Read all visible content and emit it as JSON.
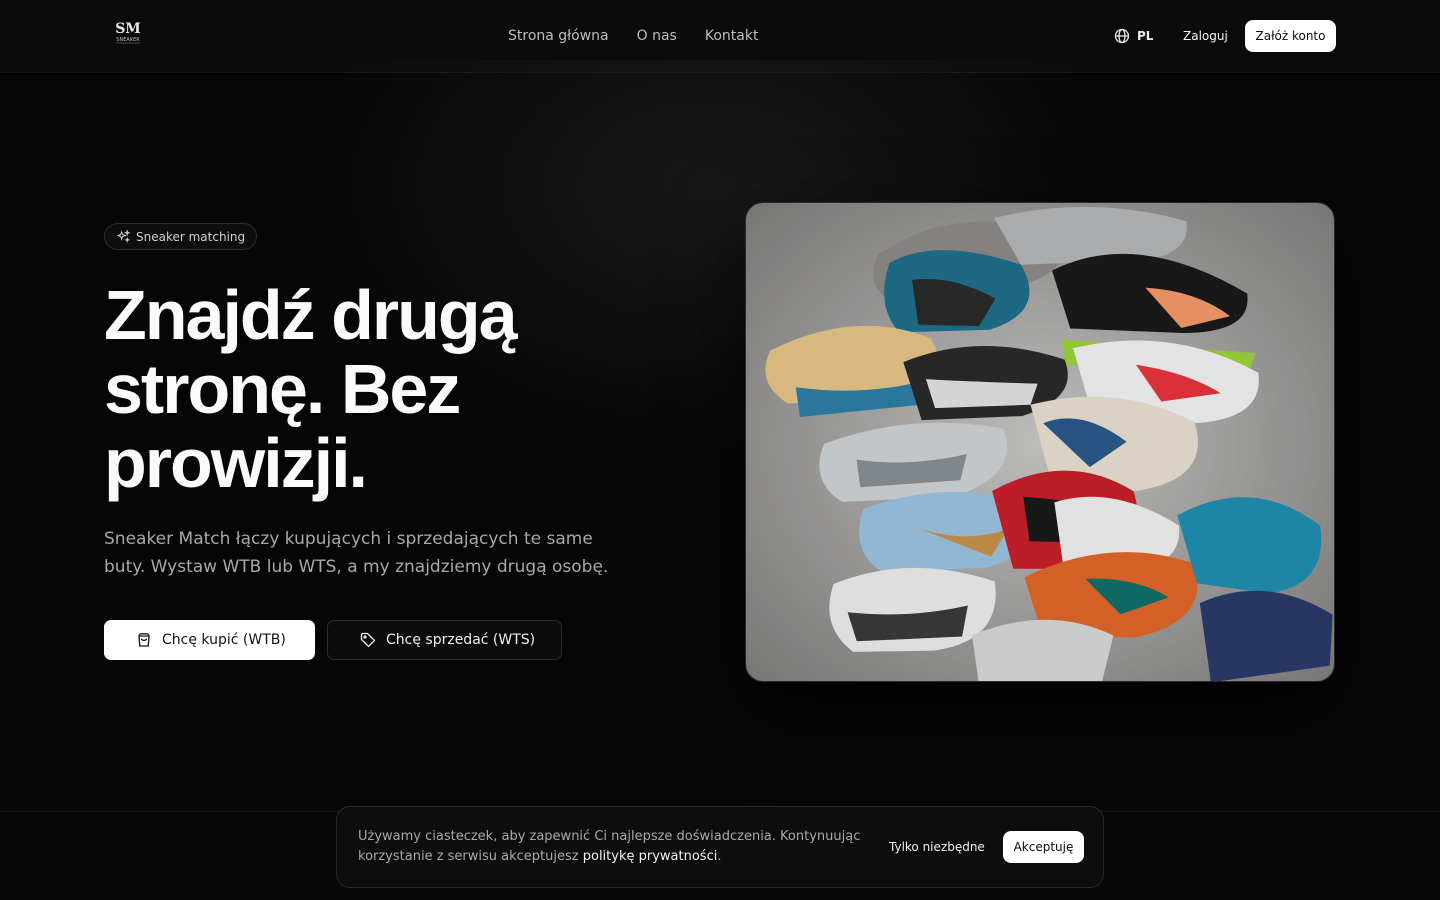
{
  "brand": {
    "logo_text": "SM",
    "logo_subtext": "SNEAKER"
  },
  "nav": {
    "items": [
      {
        "label": "Strona główna"
      },
      {
        "label": "O nas"
      },
      {
        "label": "Kontakt"
      }
    ]
  },
  "header": {
    "language": "PL",
    "login_label": "Zaloguj",
    "signup_label": "Załóż konto"
  },
  "hero": {
    "badge": "Sneaker matching",
    "headline_line1": "Znajdź drugą",
    "headline_line2": "stronę. Bez",
    "headline_line3": "prowizji.",
    "subtext": "Sneaker Match łączy kupujących i sprzedających te same buty. Wystaw WTB lub WTS, a my znajdziemy drugą osobę.",
    "buy_label": "Chcę kupić (WTB)",
    "sell_label": "Chcę sprzedać (WTS)"
  },
  "cookie": {
    "text_before": "Używamy ciasteczek, aby zapewnić Ci najlepsze doświadczenia. Kontynuując korzystanie z serwisu akceptujesz ",
    "link_label": "politykę prywatności",
    "text_after": ".",
    "essential_label": "Tylko niezbędne",
    "accept_label": "Akceptuję"
  },
  "icons": {
    "badge": "sparkles-icon",
    "language": "globe-icon",
    "buy": "shopping-bag-icon",
    "sell": "tag-icon"
  },
  "colors": {
    "background": "#060606",
    "primary_button": "#ffffff",
    "text_muted": "#a8a8a8"
  }
}
